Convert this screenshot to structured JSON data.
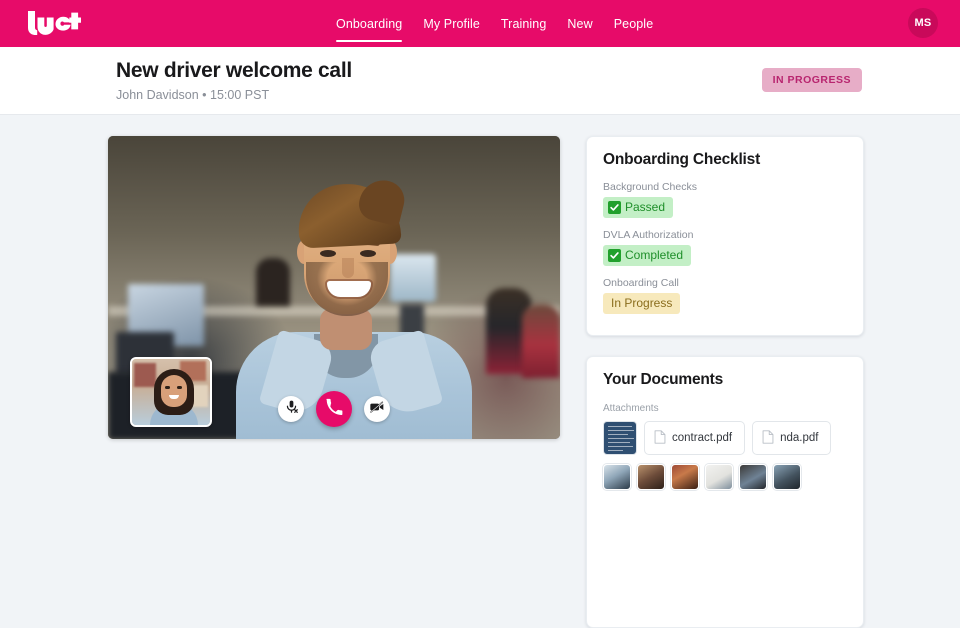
{
  "topbar": {
    "logo_name": "lyft-logo",
    "brand_color": "#e70b69",
    "nav": [
      {
        "label": "Onboarding",
        "active": true
      },
      {
        "label": "My Profile",
        "active": false
      },
      {
        "label": "Training",
        "active": false
      },
      {
        "label": "New",
        "active": false
      },
      {
        "label": "People",
        "active": false
      }
    ],
    "avatar_initials": "MS"
  },
  "page_header": {
    "title": "New driver welcome call",
    "subtitle": "John Davidson • 15:00 PST",
    "status_badge": "IN PROGRESS",
    "status_badge_bg": "#e7adc7",
    "status_badge_color": "#b8256f"
  },
  "video_call": {
    "controls": [
      {
        "name": "mute-microphone-button",
        "icon": "microphone-muted-icon"
      },
      {
        "name": "hangup-button",
        "icon": "phone-icon",
        "color": "#e70b69"
      },
      {
        "name": "stop-video-button",
        "icon": "camera-off-icon"
      }
    ],
    "self_view_label": "picture-in-picture-self-view"
  },
  "checklist": {
    "title": "Onboarding Checklist",
    "items": [
      {
        "label": "Background Checks",
        "status": "Passed",
        "tone": "green",
        "check": true
      },
      {
        "label": "DVLA Authorization",
        "status": "Completed",
        "tone": "green",
        "check": true
      },
      {
        "label": "Onboarding Call",
        "status": "In Progress",
        "tone": "yellow",
        "check": false
      }
    ],
    "tone_colors": {
      "green_bg": "#c3efc6",
      "green_text": "#1f8f2a",
      "yellow_bg": "#f7e9bc",
      "yellow_text": "#8a6d1d"
    }
  },
  "documents": {
    "title": "Your Documents",
    "attachments_label": "Attachments",
    "files": [
      {
        "name": "contract.pdf"
      },
      {
        "name": "nda.pdf"
      }
    ],
    "doc_preview_name": "document-preview-thumbnail",
    "photos": [
      {
        "name": "photo-thumbnail-1"
      },
      {
        "name": "photo-thumbnail-2"
      },
      {
        "name": "photo-thumbnail-3"
      },
      {
        "name": "photo-thumbnail-4"
      },
      {
        "name": "photo-thumbnail-5"
      },
      {
        "name": "photo-thumbnail-6"
      }
    ]
  }
}
